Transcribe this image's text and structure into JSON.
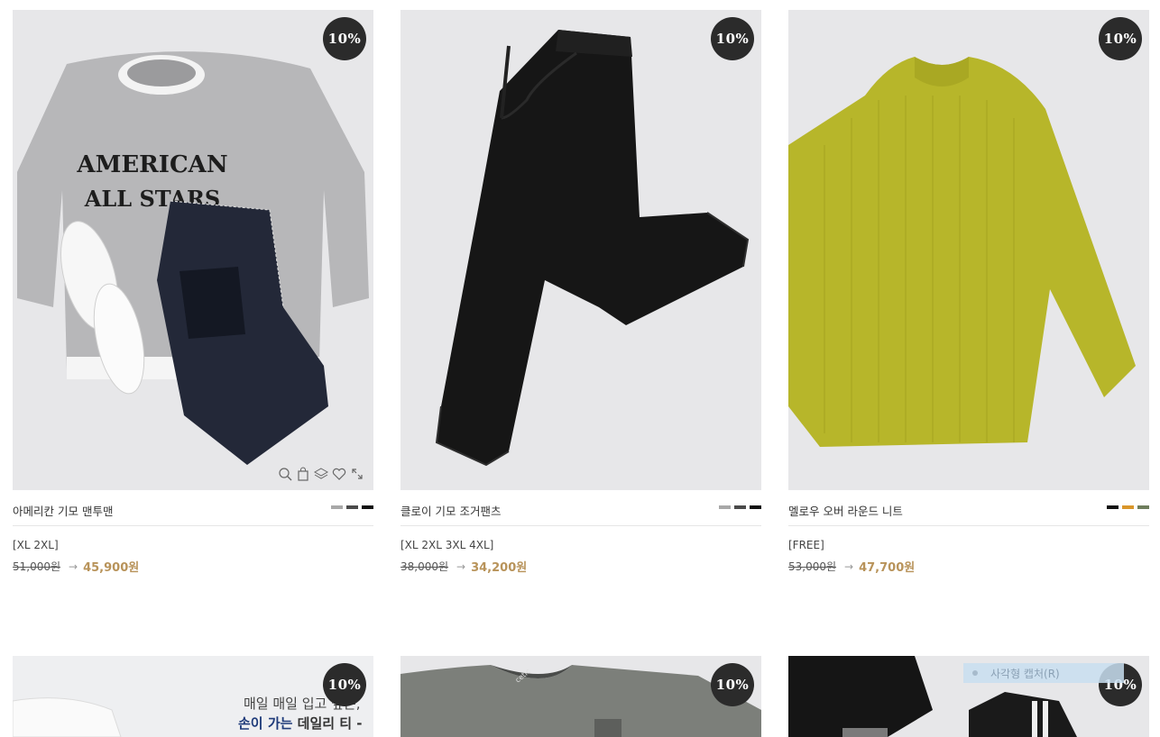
{
  "products": [
    {
      "discount": "10%",
      "name": "아메리칸 기모 맨투맨",
      "sizes": "[XL 2XL]",
      "original_price": "51,000원",
      "sale_price": "45,900원",
      "swatches": [
        "#a8a8a8",
        "#4a4a4a",
        "#111111"
      ],
      "image_text_1": "AMERICAN",
      "image_text_2": "ALL STARS"
    },
    {
      "discount": "10%",
      "name": "클로이 기모 조거팬츠",
      "sizes": "[XL 2XL 3XL 4XL]",
      "original_price": "38,000원",
      "sale_price": "34,200원",
      "swatches": [
        "#a8a8a8",
        "#4a4a4a",
        "#111111"
      ]
    },
    {
      "discount": "10%",
      "name": "멜로우 오버 라운드 니트",
      "sizes": "[FREE]",
      "original_price": "53,000원",
      "sale_price": "47,700원",
      "swatches": [
        "#111111",
        "#d9962a",
        "#6e7d5c"
      ]
    },
    {
      "discount": "10%",
      "ad_line_1": "매일 매일 입고 싶은,",
      "ad_line_2_highlight": "손이 가는",
      "ad_line_2_rest": " 데일리 티 -"
    },
    {
      "discount": "10%",
      "collar_text": "cetic"
    },
    {
      "discount": "10%"
    }
  ],
  "arrow_glyph": "→",
  "capture_overlay": {
    "label": "사각형 캡처(R)"
  },
  "colors": {
    "badge_bg": "#2b2b2b",
    "sale_price": "#b8935a",
    "thumb_bg": "#e7e7e9"
  },
  "icons": [
    "zoom-icon",
    "cart-icon",
    "layers-icon",
    "heart-icon",
    "expand-icon"
  ]
}
